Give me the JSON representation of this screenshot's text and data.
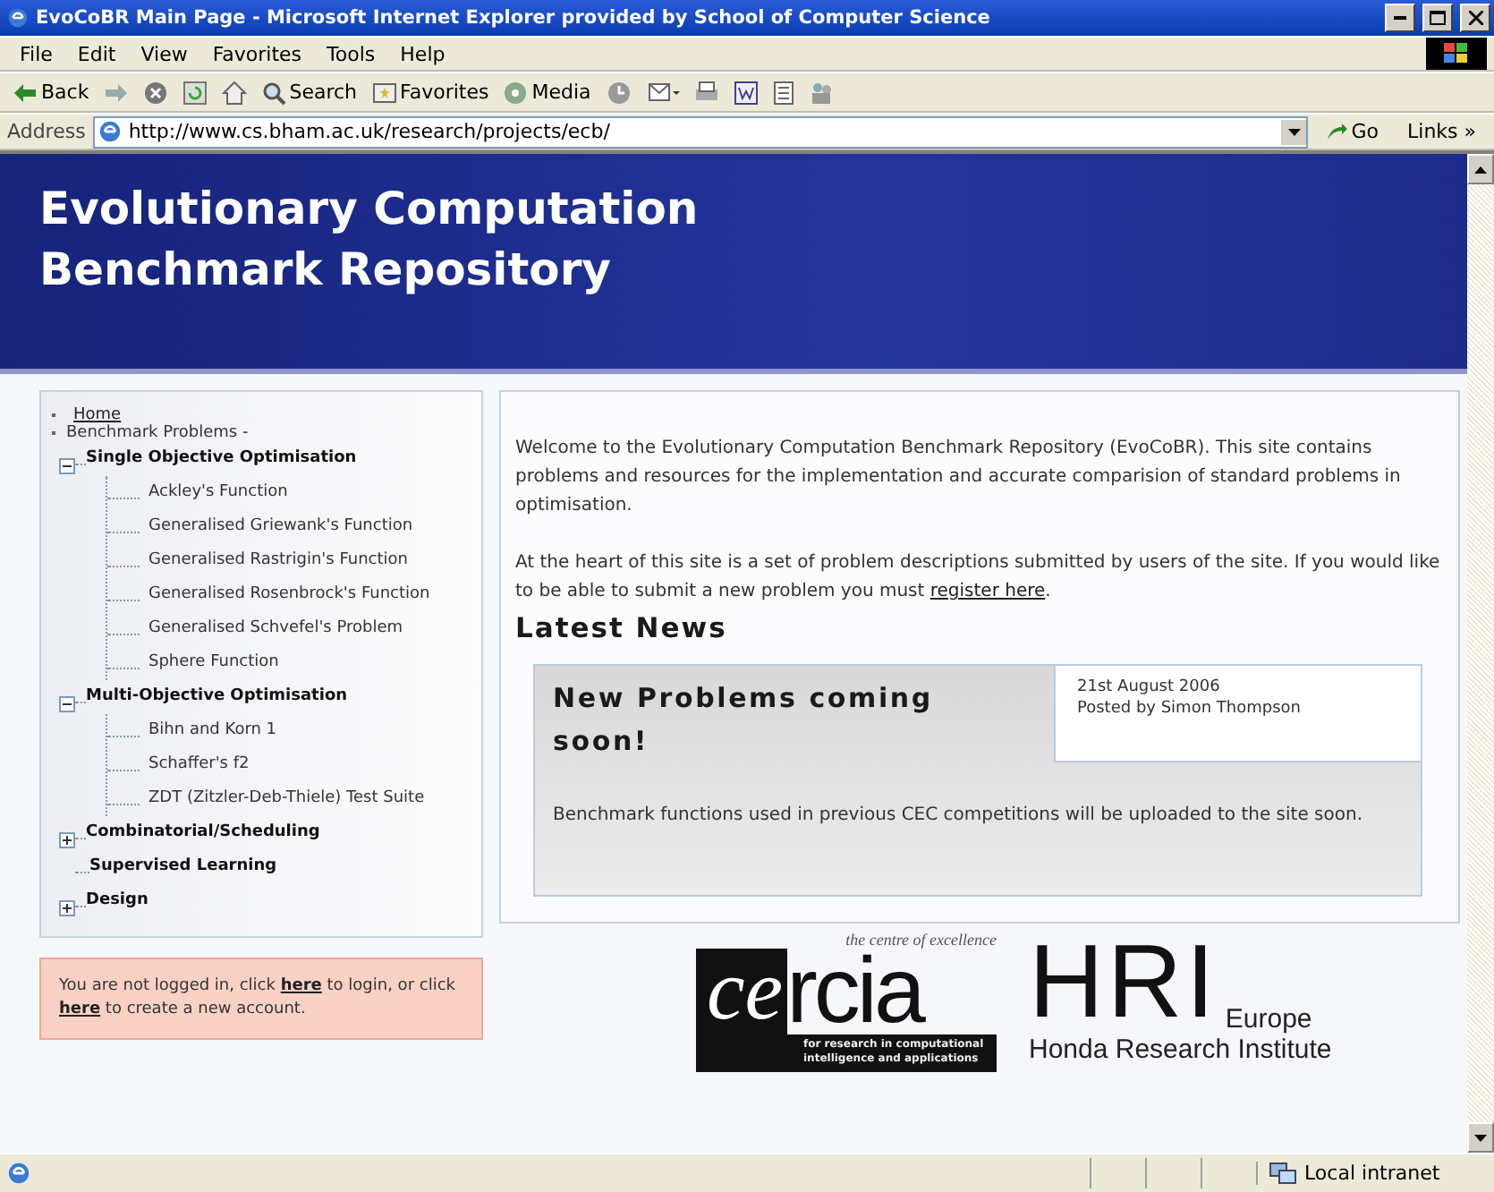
{
  "window": {
    "title": "EvoCoBR Main Page - Microsoft Internet Explorer provided by School of Computer Science"
  },
  "menu": [
    "File",
    "Edit",
    "View",
    "Favorites",
    "Tools",
    "Help"
  ],
  "toolbar": [
    {
      "kind": "back",
      "label": "Back"
    },
    {
      "kind": "forward"
    },
    {
      "kind": "stop"
    },
    {
      "kind": "refresh"
    },
    {
      "kind": "home"
    },
    {
      "kind": "search",
      "label": "Search"
    },
    {
      "kind": "favorites",
      "label": "Favorites"
    },
    {
      "kind": "media",
      "label": "Media"
    },
    {
      "kind": "history"
    },
    {
      "kind": "mail"
    },
    {
      "kind": "print"
    },
    {
      "kind": "word"
    },
    {
      "kind": "discuss"
    },
    {
      "kind": "messenger"
    }
  ],
  "address": {
    "label": "Address",
    "url": "http://www.cs.bham.ac.uk/research/projects/ecb/",
    "go": "Go",
    "links": "Links »"
  },
  "header": {
    "title_lines": [
      "Evolutionary Computation",
      "Benchmark Repository"
    ]
  },
  "sidebar": {
    "home": "Home",
    "section": "Benchmark Problems -",
    "tree": [
      {
        "label": "Single Objective Optimisation",
        "kind": "folder",
        "expanded": true,
        "children": [
          {
            "label": "Ackley's Function"
          },
          {
            "label": "Generalised Griewank's Function"
          },
          {
            "label": "Generalised Rastrigin's Function"
          },
          {
            "label": "Generalised Rosenbrock's Function"
          },
          {
            "label": "Generalised Schvefel's Problem"
          },
          {
            "label": "Sphere Function"
          }
        ]
      },
      {
        "label": "Multi-Objective Optimisation",
        "kind": "folder",
        "expanded": true,
        "children": [
          {
            "label": "Bihn and Korn 1"
          },
          {
            "label": "Schaffer's f2"
          },
          {
            "label": "ZDT (Zitzler-Deb-Thiele) Test Suite"
          }
        ]
      },
      {
        "label": "Combinatorial/Scheduling",
        "kind": "folder",
        "expanded": false
      },
      {
        "label": "Supervised Learning",
        "kind": "plain"
      },
      {
        "label": "Design",
        "kind": "folder",
        "expanded": false
      }
    ]
  },
  "login": {
    "text_1": "You are not logged in, click ",
    "link_1": "here",
    "text_2": " to login, or click ",
    "link_2": "here",
    "text_3": " to create a new account."
  },
  "main": {
    "intro": "Welcome to the Evolutionary Computation Benchmark Repository (EvoCoBR). This site contains problems and resources for the implementation and accurate comparision of standard problems in optimisation.",
    "heart": "At the heart of this site is a set of problem descriptions submitted by users of the site. If you would like to be able to submit a new problem you must ",
    "register_link": "register here",
    "heart_end": ".",
    "news_heading": "Latest News",
    "news": [
      {
        "title": "New Problems coming soon!",
        "date": "21st August 2006",
        "author": "Posted by Simon Thompson",
        "body": "Benchmark functions used in previous CEC competitions will be uploaded to the site soon."
      }
    ]
  },
  "logos": {
    "cercia": {
      "tagline": "the centre of excellence",
      "name_1": "ce",
      "name_2": "rcia",
      "subline": "for research in computational intelligence and applications"
    },
    "hri": {
      "mark": "HRI",
      "region": "Europe",
      "name": "Honda Research Institute"
    }
  },
  "status_bar": {
    "zone": "Local intranet"
  }
}
